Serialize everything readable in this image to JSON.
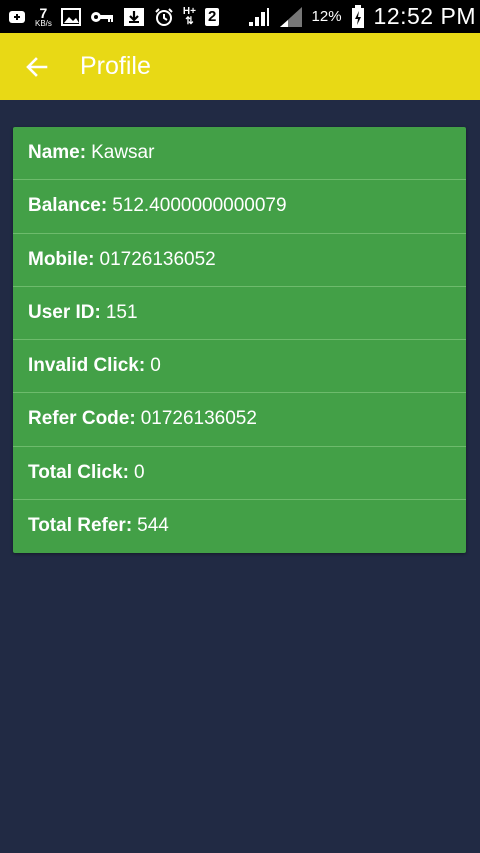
{
  "status_bar": {
    "net_speed_value": "7",
    "net_speed_unit": "KB/s",
    "network_type": "H+",
    "sim_slot": "2",
    "battery_percent": "12%",
    "time": "12:52 PM"
  },
  "app_bar": {
    "title": "Profile",
    "back_icon": "arrow-left-icon",
    "color": "#e8d915"
  },
  "profile": {
    "card_color": "#43a047",
    "fields": [
      {
        "label": "Name:",
        "value": "Kawsar"
      },
      {
        "label": "Balance:",
        "value": "512.4000000000079"
      },
      {
        "label": "Mobile:",
        "value": "01726136052"
      },
      {
        "label": "User ID:",
        "value": "151"
      },
      {
        "label": "Invalid Click:",
        "value": "0"
      },
      {
        "label": "Refer Code:",
        "value": "01726136052"
      },
      {
        "label": "Total Click:",
        "value": "0"
      },
      {
        "label": "Total Refer:",
        "value": "544"
      }
    ]
  }
}
